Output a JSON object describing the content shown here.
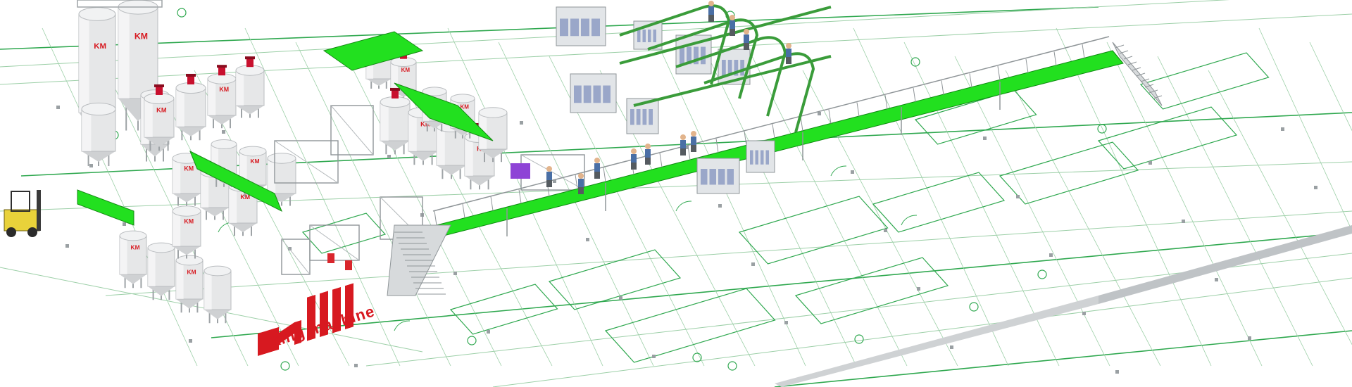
{
  "scene": {
    "title": "",
    "logo_text": "king machine",
    "tank_logo_text": "KM",
    "colors": {
      "background": "#ffffff",
      "plan_lines": "#2fa84f",
      "plan_lines_light": "#9ccfa7",
      "walkway": "#22e01f",
      "steel": "#cfd3d6",
      "tank": "#e6e7e8",
      "logo_red": "#d71920",
      "forklift": "#e9d23a",
      "motor_red": "#c8102e",
      "machine_purple": "#8e44d6"
    }
  }
}
